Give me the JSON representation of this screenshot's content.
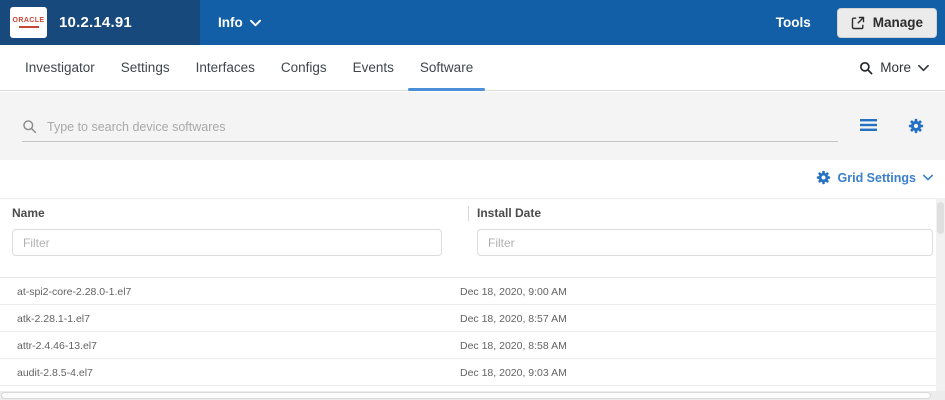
{
  "header": {
    "logo_text": "ORACLE",
    "device_ip": "10.2.14.91",
    "info_label": "Info",
    "tools_label": "Tools",
    "manage_label": "Manage"
  },
  "tabs": {
    "items": [
      {
        "label": "Investigator"
      },
      {
        "label": "Settings"
      },
      {
        "label": "Interfaces"
      },
      {
        "label": "Configs"
      },
      {
        "label": "Events"
      },
      {
        "label": "Software"
      }
    ],
    "active": "Software",
    "more_label": "More"
  },
  "search": {
    "placeholder": "Type to search device softwares"
  },
  "grid": {
    "settings_label": "Grid Settings"
  },
  "table": {
    "columns": [
      {
        "label": "Name"
      },
      {
        "label": "Install Date"
      }
    ],
    "filter_placeholder": "Filter",
    "rows": [
      {
        "name": "at-spi2-core-2.28.0-1.el7",
        "install_date": "Dec 18, 2020, 9:00 AM"
      },
      {
        "name": "atk-2.28.1-1.el7",
        "install_date": "Dec 18, 2020, 8:57 AM"
      },
      {
        "name": "attr-2.4.46-13.el7",
        "install_date": "Dec 18, 2020, 8:58 AM"
      },
      {
        "name": "audit-2.8.5-4.el7",
        "install_date": "Dec 18, 2020, 9:03 AM"
      }
    ]
  },
  "colors": {
    "header_left_bg": "#17497d",
    "header_right_bg": "#135fa7",
    "logo_red": "#c74634",
    "accent_blue": "#2470c3",
    "active_tab_underline": "#4a8fd8",
    "grid_settings_blue": "#3b80c9",
    "band_gray": "#f4f4f5"
  }
}
